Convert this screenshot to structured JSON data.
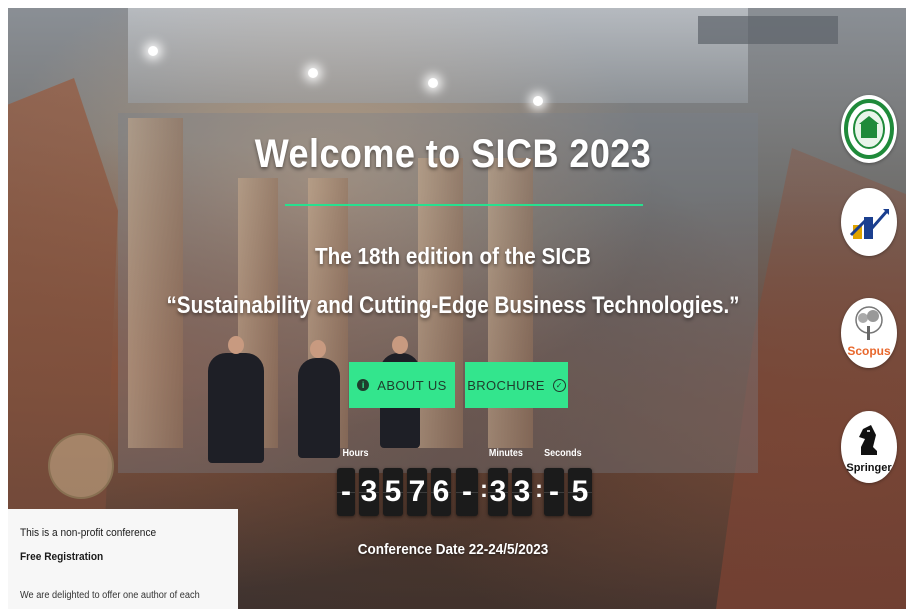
{
  "hero": {
    "title": "Welcome to SICB 2023",
    "subtitle": "The 18th edition of the SICB",
    "theme": "“Sustainability and Cutting-Edge Business Technologies.”",
    "conference_date": "Conference Date 22-24/5/2023"
  },
  "buttons": {
    "about_label": "ABOUT US",
    "about_icon": "info-icon",
    "brochure_label": "BROCHURE",
    "brochure_icon": "check-circle-icon"
  },
  "countdown": {
    "hours_label": "Hours",
    "minutes_label": "Minutes",
    "seconds_label": "Seconds",
    "hours_digits": [
      "-",
      "3",
      "5",
      "7",
      "6",
      "-"
    ],
    "minutes_digits": [
      "3",
      "3"
    ],
    "seconds_digits": [
      "-",
      "5"
    ],
    "separator": ":"
  },
  "notice": {
    "line1": "This is a non-profit conference",
    "line2": "Free Registration",
    "line3": "We are delighted to offer one author of each"
  },
  "logos": {
    "scopus": "Scopus",
    "springer": "Springer"
  },
  "colors": {
    "accent_green": "#33e58d",
    "rule_green": "#27e08f",
    "digit_bg": "#1b1b1b",
    "scopus_orange": "#e8672c"
  }
}
